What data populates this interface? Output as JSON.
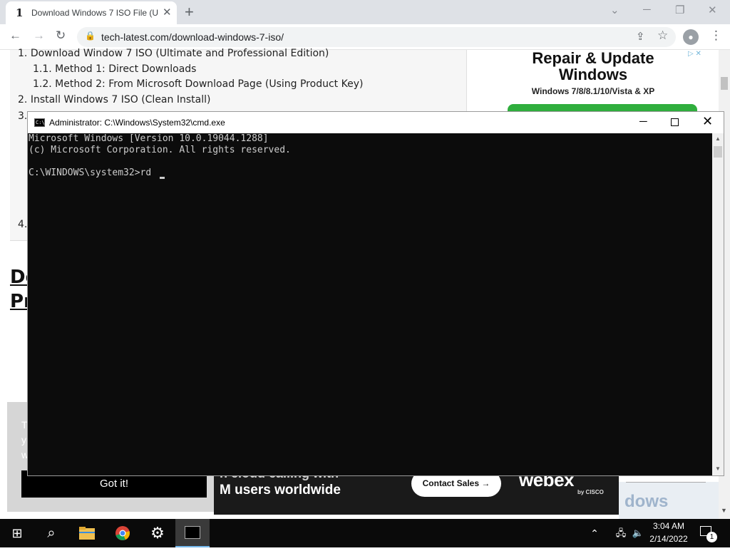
{
  "browser": {
    "tab_title": "Download Windows 7 ISO File (U",
    "favicon_glyph": "1",
    "url": "tech-latest.com/download-windows-7-iso/"
  },
  "toc": {
    "items": [
      {
        "num": "1.",
        "text": "Download Window 7 ISO (Ultimate and Professional Edition)"
      },
      {
        "num": "1.1.",
        "text": "Method 1: Direct Downloads"
      },
      {
        "num": "1.2.",
        "text": "Method 2: From Microsoft Download Page (Using Product Key)"
      },
      {
        "num": "2.",
        "text": "Install Windows 7 ISO (Clean Install)"
      },
      {
        "num": "3.",
        "text": ""
      },
      {
        "num": "4.",
        "text": ""
      }
    ]
  },
  "heading": {
    "line1": "Do",
    "line2": "Pr"
  },
  "ad_right": {
    "line1": "Repair & Update",
    "line2": "Windows",
    "sub": "Windows 7/8/8.1/10/Vista & XP"
  },
  "cookie": {
    "text_lines": [
      "T",
      "y",
      "w"
    ],
    "button": "Got it!"
  },
  "webex_ad": {
    "line1": "n cloud calling with",
    "line2": "M users worldwide",
    "cta": "Contact Sales →",
    "brand": "webex",
    "by": "by CISCO"
  },
  "right_bottom_ad": {
    "text": "dows"
  },
  "cmd": {
    "title": "Administrator: C:\\Windows\\System32\\cmd.exe",
    "lines": [
      "Microsoft Windows [Version 10.0.19044.1288]",
      "(c) Microsoft Corporation. All rights reserved.",
      "",
      "C:\\WINDOWS\\system32>rd"
    ]
  },
  "taskbar": {
    "time": "3:04 AM",
    "date": "2/14/2022",
    "notification_count": "1"
  },
  "icons": {
    "back": "←",
    "forward": "→",
    "reload": "↻",
    "lock": "🔒",
    "share": "⇪",
    "star": "☆",
    "menu": "⋮",
    "close": "✕",
    "plus": "+",
    "minimize": "─",
    "restore": "❐",
    "start": "⊞",
    "search": "⌕",
    "gear": "⚙",
    "tray_up": "⌃",
    "speaker": "🔈"
  }
}
